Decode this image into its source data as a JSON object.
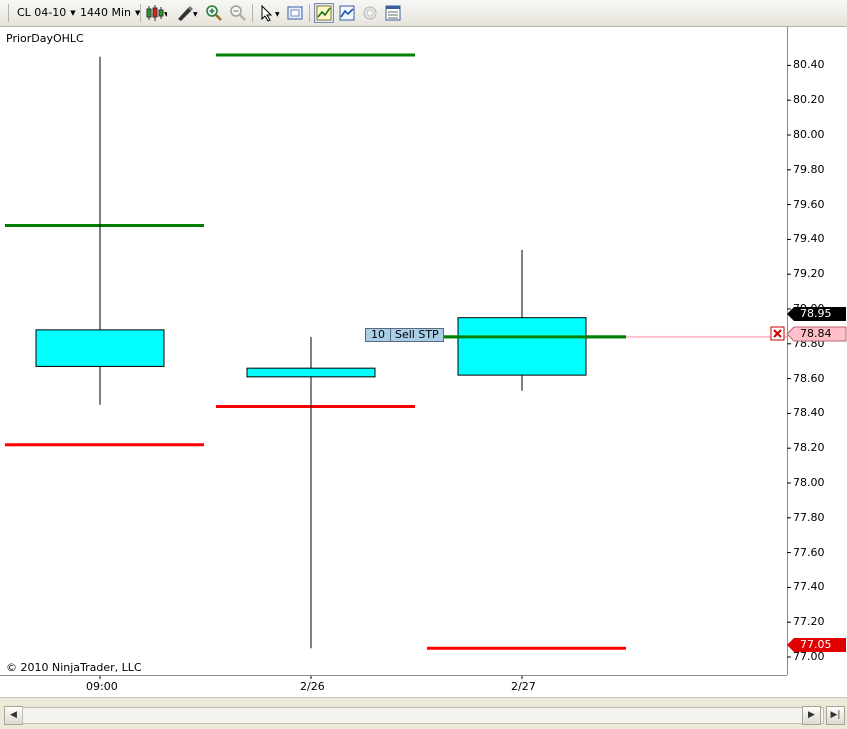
{
  "toolbar": {
    "instrument": "CL 04-10",
    "interval": "1440 Min",
    "icons": [
      "candlestick-style-icon",
      "drawing-tool-icon",
      "zoom-in-icon",
      "zoom-out-icon",
      "pointer-icon",
      "properties-icon",
      "indicators-icon",
      "strategies-icon",
      "chart-trader-icon",
      "data-box-icon"
    ]
  },
  "chart": {
    "indicator_label": "PriorDayOHLC",
    "copyright": "© 2010 NinjaTrader, LLC",
    "y_ticks": [
      "80.40",
      "80.20",
      "80.00",
      "79.80",
      "79.60",
      "79.40",
      "79.20",
      "79.00",
      "78.80",
      "78.60",
      "78.40",
      "78.20",
      "78.00",
      "77.80",
      "77.60",
      "77.40",
      "77.20",
      "77.00"
    ],
    "x_labels": [
      "09:00",
      "2/26",
      "2/27"
    ],
    "order": {
      "qty": "10",
      "type": "Sell STP"
    },
    "price_markers": {
      "last": "78.95",
      "stop": "78.84",
      "low": "77.05"
    },
    "colors": {
      "up_body": "#00ffff",
      "down_body": "#ffa500",
      "prior_high": "#008000",
      "prior_low": "#ff0000",
      "stop_line": "#ffc0cb"
    }
  },
  "chart_data": {
    "type": "candlestick",
    "bars": [
      {
        "label": "09:00",
        "open": 78.67,
        "high": 80.45,
        "low": 78.45,
        "close": 78.88
      },
      {
        "label": "2/26",
        "open": 78.61,
        "high": 78.84,
        "low": 77.05,
        "close": 78.66
      },
      {
        "label": "2/27",
        "open": 78.62,
        "high": 79.34,
        "low": 78.53,
        "close": 78.95
      }
    ],
    "prior_day_lines": [
      {
        "bar": 0,
        "high": 79.48,
        "low": 78.22
      },
      {
        "bar": 1,
        "high": 80.46,
        "low": 78.44
      },
      {
        "bar": 2,
        "high": 78.84,
        "low": 77.05
      }
    ],
    "order_price": 78.84,
    "ylim": [
      77.0,
      80.5
    ],
    "title": "PriorDayOHLC"
  }
}
